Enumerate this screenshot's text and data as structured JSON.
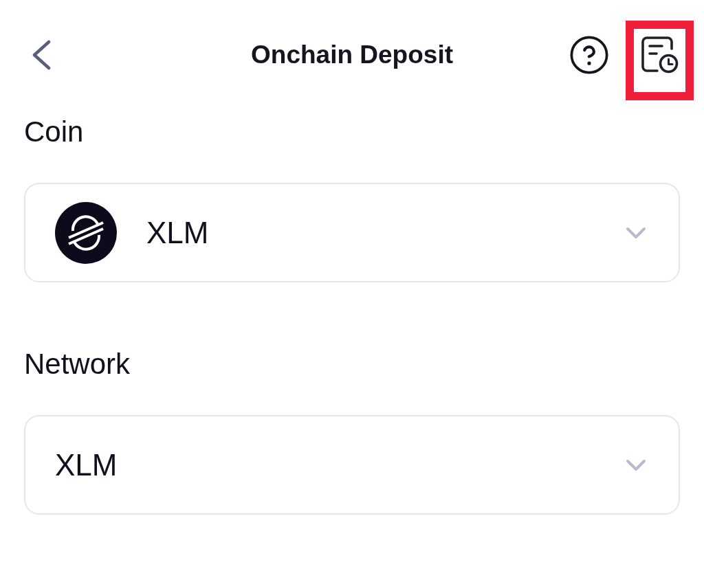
{
  "header": {
    "title": "Onchain Deposit",
    "history": {
      "highlighted": true
    }
  },
  "fields": [
    {
      "label": "Coin",
      "kind": "coin",
      "value": "XLM"
    },
    {
      "label": "Network",
      "kind": "plain",
      "value": "XLM"
    }
  ]
}
